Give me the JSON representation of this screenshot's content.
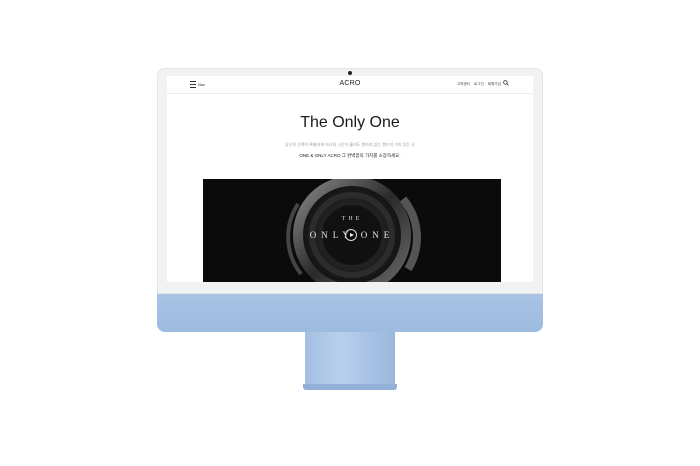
{
  "site": {
    "menu_label": "Nav",
    "logo": "ACRO",
    "utility_links": [
      "고객센터",
      "로그인",
      "회원가입"
    ],
    "search_icon": "search-icon"
  },
  "hero": {
    "title": "The Only One",
    "subtitle": "당신의 선택이 특별하게 하나의 시간이 흘러도 변하지 않는 캔드의 가치 있는 곳",
    "tagline": "ONE & ONLY ACRO 그 완벽함의 가치를 소장하세요."
  },
  "video": {
    "line1": "THE",
    "line2": "ONLY ONE",
    "play_icon": "play-icon"
  },
  "colors": {
    "monitor_blue": "#a9c4e4",
    "bezel": "#f1f2f4",
    "video_bg": "#0b0b0b"
  }
}
